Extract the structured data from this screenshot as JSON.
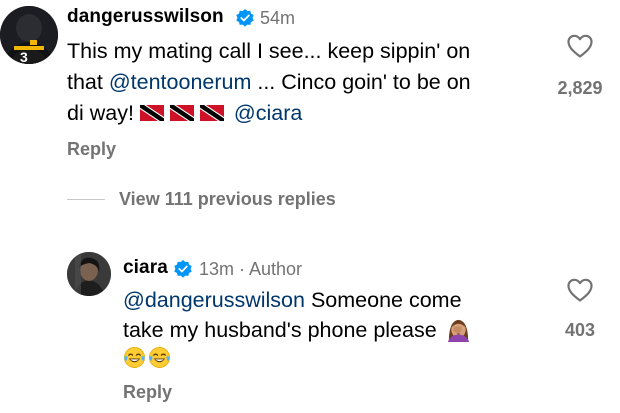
{
  "comment": {
    "username": "dangerusswilson",
    "time": "54m",
    "line1": "This my mating call I see... keep sippin' on",
    "line2_pre": "that ",
    "line2_mention": "@tentoonerum",
    "line2_post": " ... Cinco goin' to be on",
    "line3_pre": "di way! ",
    "line3_mention": "@ciara",
    "flag_icon": "trinidad-tobago-flag-icon",
    "like_count": "2,829",
    "reply_label": "Reply",
    "avatar_jersey_number": "3"
  },
  "view_replies_label": "View 111 previous replies",
  "reply": {
    "username": "ciara",
    "meta": "13m · Author",
    "mention": "@dangerusswilson",
    "line1_post": " Someone come",
    "line2": "take my husband's phone please",
    "like_count": "403",
    "reply_label": "Reply",
    "emoji_icons": [
      "facepalm-woman-emoji",
      "tears-of-joy-emoji"
    ]
  },
  "colors": {
    "mention": "#00376b",
    "secondary_text": "#737373",
    "verified_badge": "#0095f6"
  }
}
